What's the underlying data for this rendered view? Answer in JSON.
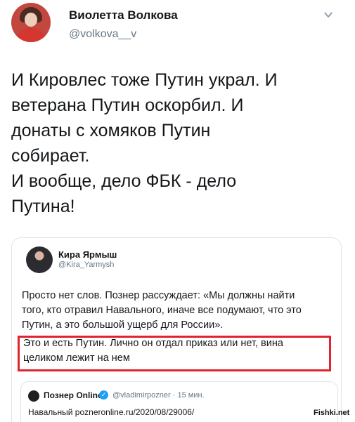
{
  "author": {
    "name": "Виолетта Волкова",
    "handle": "@volkova__v"
  },
  "tweet": {
    "lines": [
      "И Кировлес тоже Путин украл. И",
      "ветерана Путин оскорбил.  И",
      "донаты с хомяков Путин",
      "собирает.",
      "И вообще, дело ФБК - дело",
      "Путина!"
    ]
  },
  "quoted": {
    "name": "Кира Ярмыш",
    "handle": "@Kira_Yarmysh",
    "text_lines": [
      "Просто нет слов. Познер рассуждает: «Мы должны найти",
      "того, кто отравил Навального, иначе все подумают, что это",
      "Путин, а это большой ущерб для России»."
    ],
    "highlight_lines": [
      "Это и есть Путин. Лично он отдал приказ или нет, вина",
      "целиком лежит на нем"
    ],
    "highlight_color": "#e0232c",
    "inner": {
      "name": "Познер Online",
      "meta": "@vladimirpozner · 15 мин.",
      "link": "Навальный pozneronline.ru/2020/08/29006/"
    }
  },
  "watermark": "Fishki.net",
  "icons": [
    "chevron-down-icon",
    "verified-icon"
  ]
}
